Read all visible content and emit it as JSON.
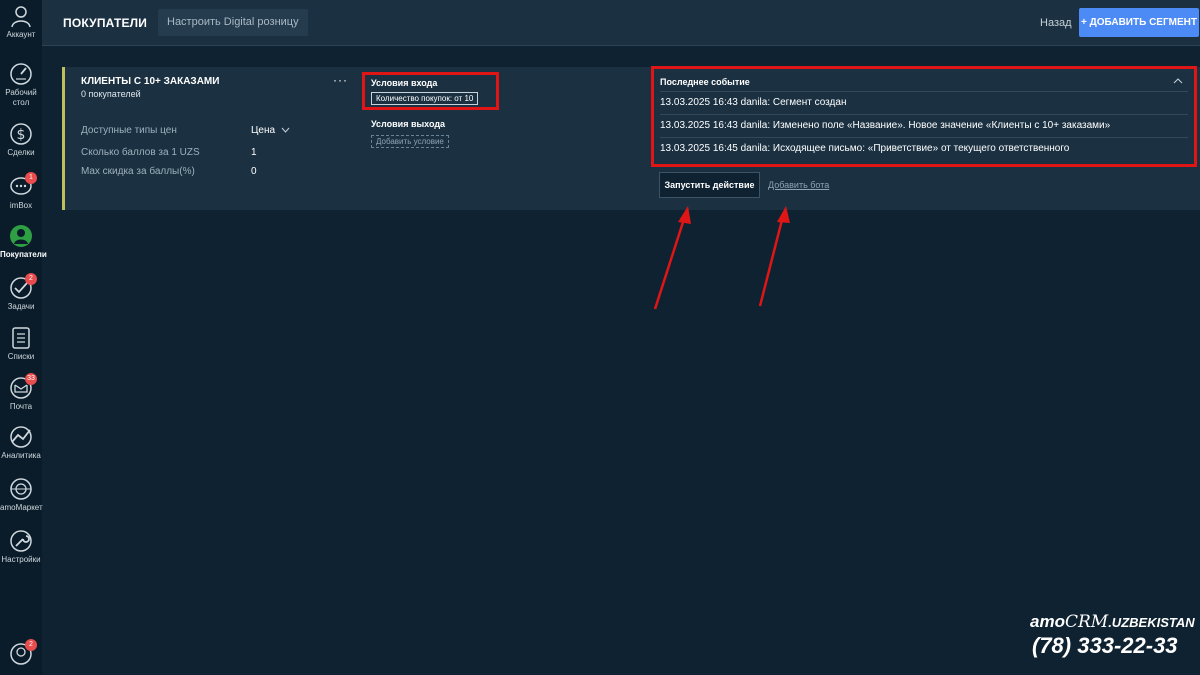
{
  "sidebar": {
    "items": [
      {
        "label": "Аккаунт",
        "icon": "account-icon"
      },
      {
        "label": "Рабочий стол",
        "icon": "dashboard-icon"
      },
      {
        "label": "Сделки",
        "icon": "dollar-icon"
      },
      {
        "label": "imBox",
        "icon": "chat-icon",
        "badge": "1"
      },
      {
        "label": "Покупатели",
        "icon": "customers-icon"
      },
      {
        "label": "Задачи",
        "icon": "check-icon",
        "badge": "2"
      },
      {
        "label": "Списки",
        "icon": "list-icon"
      },
      {
        "label": "Почта",
        "icon": "mail-icon",
        "badge": "33"
      },
      {
        "label": "Аналитика",
        "icon": "analytics-icon"
      },
      {
        "label": "amoМаркет",
        "icon": "market-icon"
      },
      {
        "label": "Настройки",
        "icon": "wrench-icon"
      }
    ],
    "bottom": {
      "icon": "support-icon",
      "badge": "2"
    }
  },
  "header": {
    "title": "ПОКУПАТЕЛИ",
    "config_button": "Настроить Digital розницу",
    "back": "Назад",
    "add_segment": "+ ДОБАВИТЬ СЕГМЕНТ"
  },
  "segment": {
    "title": "КЛИЕНТЫ С 10+ ЗАКАЗАМИ",
    "count": "0 покупателей",
    "more": "···",
    "params": [
      {
        "label": "Доступные типы цен",
        "value": "Цена"
      },
      {
        "label": "Сколько баллов за 1 UZS",
        "value": "1"
      },
      {
        "label": "Max скидка за баллы(%)",
        "value": "0"
      }
    ],
    "entry_label": "Условия входа",
    "entry_condition": "Количество покупок: от 10",
    "exit_label": "Условия выхода",
    "add_condition": "Добавить условие",
    "events_title": "Последнее событие",
    "events": [
      "13.03.2025 16:43  danila: Сегмент создан",
      "13.03.2025 16:43  danila: Изменено поле «Название». Новое значение «Клиенты с 10+ заказами»",
      "13.03.2025 16:45  danila: Исходящее письмо: «Приветствие» от текущего ответственного"
    ],
    "run_action": "Запустить действие",
    "add_bot": "Добавить бота"
  },
  "watermark": {
    "brand_amo": "amo",
    "brand_crm": "CRM",
    "brand_region": ".UZBEKISTAN",
    "phone": "(78) 333-22-33"
  },
  "colors": {
    "accent": "#4c8bf5",
    "highlight": "#e01616",
    "segment_stripe": "#bdbf5d",
    "badge": "#e84c4c"
  }
}
